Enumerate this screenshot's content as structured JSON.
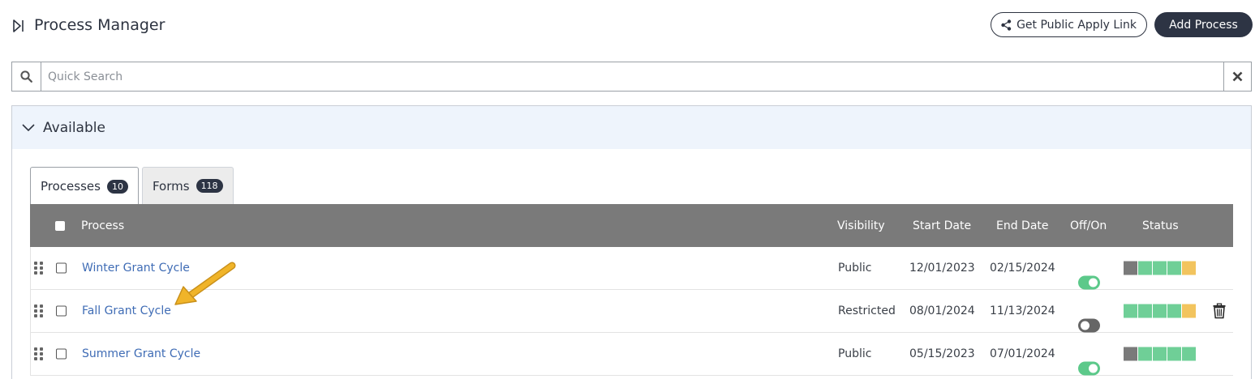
{
  "header": {
    "title": "Process Manager",
    "public_link_label": "Get Public Apply Link",
    "add_process_label": "Add Process"
  },
  "search": {
    "placeholder": "Quick Search",
    "value": ""
  },
  "panel": {
    "title": "Available"
  },
  "tabs": [
    {
      "label": "Processes",
      "count": "10",
      "active": true
    },
    {
      "label": "Forms",
      "count": "118",
      "active": false
    }
  ],
  "table": {
    "columns": {
      "process": "Process",
      "visibility": "Visibility",
      "start_date": "Start Date",
      "end_date": "End Date",
      "off_on": "Off/On",
      "status": "Status"
    },
    "rows": [
      {
        "name": "Winter Grant Cycle",
        "visibility": "Public",
        "start": "12/01/2023",
        "end": "02/15/2024",
        "enabled": true,
        "status": [
          "gray",
          "green",
          "green",
          "green",
          "yellow"
        ],
        "deletable": false
      },
      {
        "name": "Fall Grant Cycle",
        "visibility": "Restricted",
        "start": "08/01/2024",
        "end": "11/13/2024",
        "enabled": false,
        "status": [
          "green",
          "green",
          "green",
          "green",
          "yellow"
        ],
        "deletable": true
      },
      {
        "name": "Summer Grant Cycle",
        "visibility": "Public",
        "start": "05/15/2023",
        "end": "07/01/2024",
        "enabled": true,
        "status": [
          "gray",
          "green",
          "green",
          "green",
          "green"
        ],
        "deletable": false
      }
    ]
  },
  "colors": {
    "gray": "#7a7a7a",
    "green": "#6fcf97",
    "yellow": "#f2c45e",
    "annotation_arrow": "#f0b429"
  },
  "icons": {
    "collapse": "sidebar-collapse-icon",
    "share": "share-icon",
    "search": "search-icon",
    "clear": "close-icon",
    "chevron": "chevron-down-icon",
    "drag": "drag-handle-icon",
    "delete": "trash-icon"
  }
}
